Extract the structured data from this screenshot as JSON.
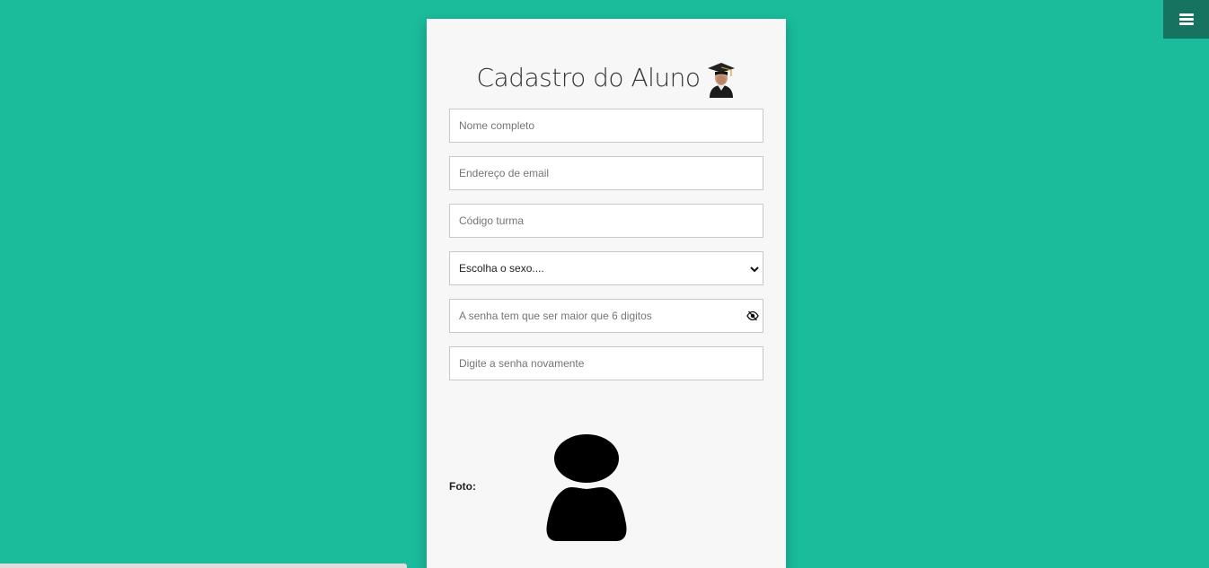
{
  "form": {
    "title": "Cadastro do Aluno",
    "title_icon": "graduate-student-icon",
    "fields": {
      "nome_placeholder": "Nome completo",
      "email_placeholder": "Endereço de email",
      "turma_placeholder": "Código turma",
      "sexo_selected": "Escolha o sexo....",
      "senha_placeholder": "A senha tem que ser maior que 6 digitos",
      "senha_confirm_placeholder": "Digite a senha novamente"
    },
    "foto_label": "Foto:",
    "avatar_icon": "user-silhouette-icon"
  },
  "menu": {
    "icon": "hamburger-menu-icon"
  },
  "colors": {
    "background": "#1abc9c",
    "menu_button": "#16735f",
    "card": "#f7f7f7"
  }
}
